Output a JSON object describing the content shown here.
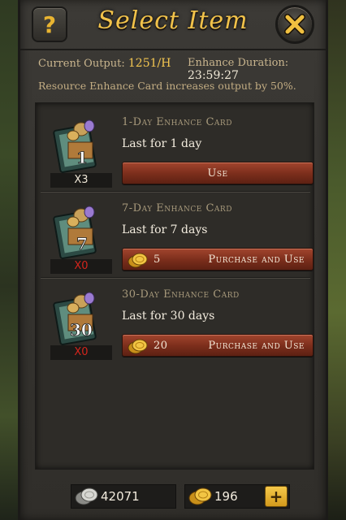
{
  "header": {
    "title": "Select Item",
    "help_label": "?",
    "close_icon": "close-icon"
  },
  "info": {
    "current_output_label": "Current Output:",
    "current_output_value": "1251/H",
    "enhance_duration_label": "Enhance Duration:",
    "enhance_duration_value": "23:59:27",
    "note": "Resource Enhance Card increases output by 50%."
  },
  "cards": [
    {
      "name": "1-Day Enhance Card",
      "desc": "Last for 1 day",
      "qty": "X3",
      "badge": "1",
      "button": {
        "label": "Use"
      }
    },
    {
      "name": "7-Day Enhance Card",
      "desc": "Last for 7 days",
      "qty": "X0",
      "badge": "7",
      "button": {
        "price": "5",
        "label": "Purchase and Use"
      }
    },
    {
      "name": "30-Day Enhance Card",
      "desc": "Last for 30 days",
      "qty": "X0",
      "badge": "30",
      "button": {
        "price": "20",
        "label": "Purchase and Use"
      }
    }
  ],
  "footer": {
    "silver": "42071",
    "gold": "196",
    "plus_label": "+"
  },
  "colors": {
    "accent_gold": "#f1c24a",
    "button_red": "#7a2d1b",
    "qty_zero": "#d4251c"
  }
}
